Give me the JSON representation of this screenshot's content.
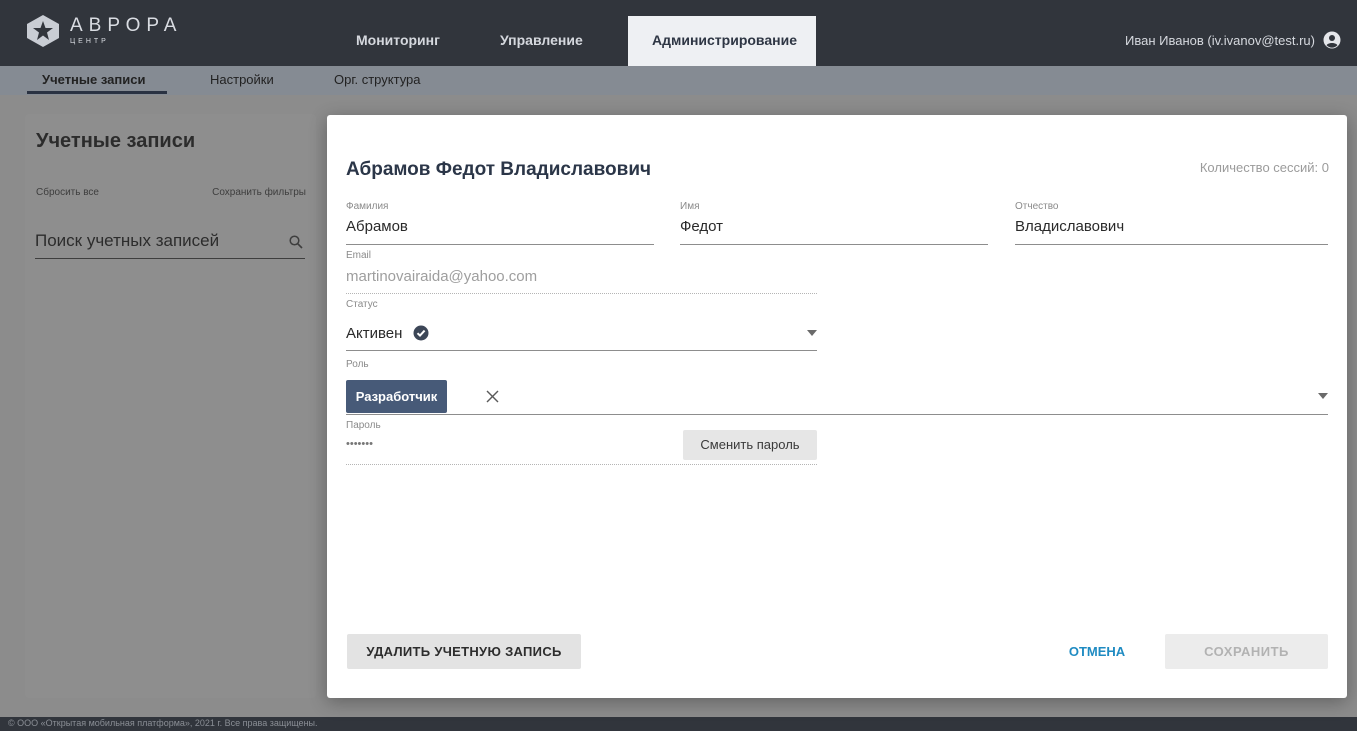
{
  "brand": {
    "title": "АВРОРА",
    "subtitle": "ЦЕНТР",
    "logo_icon": "star-logo-icon"
  },
  "main_nav": [
    {
      "label": "Мониторинг"
    },
    {
      "label": "Управление"
    },
    {
      "label": "Администрирование",
      "active": true
    }
  ],
  "user": {
    "name": "Иван Иванов (iv.ivanov@test.ru)",
    "icon": "user-circle-icon"
  },
  "sub_nav": [
    {
      "label": "Учетные записи",
      "active": true
    },
    {
      "label": "Настройки"
    },
    {
      "label": "Орг. структура"
    }
  ],
  "left_panel": {
    "title": "Учетные записи",
    "reset_label": "Сбросить все",
    "save_filters_label": "Сохранить фильтры",
    "search_placeholder": "Поиск учетных записей"
  },
  "modal": {
    "title": "Абрамов Федот Владиславович",
    "session_count": "Количество сессий: 0",
    "fields": {
      "last_name": {
        "label": "Фамилия",
        "value": "Абрамов"
      },
      "first_name": {
        "label": "Имя",
        "value": "Федот"
      },
      "middle_name": {
        "label": "Отчество",
        "value": "Владиславович"
      },
      "email": {
        "label": "Email",
        "value": "martinovairaida@yahoo.com"
      },
      "status": {
        "label": "Статус",
        "value": "Активен"
      },
      "role": {
        "label": "Роль",
        "chip": "Разработчик"
      },
      "password": {
        "label": "Пароль",
        "value": "•••••••"
      }
    },
    "change_password_label": "Сменить пароль",
    "delete_label": "УДАЛИТЬ УЧЕТНУЮ ЗАПИСЬ",
    "cancel_label": "ОТМЕНА",
    "save_label": "СОХРАНИТЬ"
  },
  "footer": {
    "text": "© ООО «Открытая мобильная платформа», 2021 г. Все права защищены."
  },
  "colors": {
    "header_bg": "#31353c",
    "accent": "#1f8bc2",
    "chip_bg": "#475a78",
    "title": "#2b3648"
  }
}
